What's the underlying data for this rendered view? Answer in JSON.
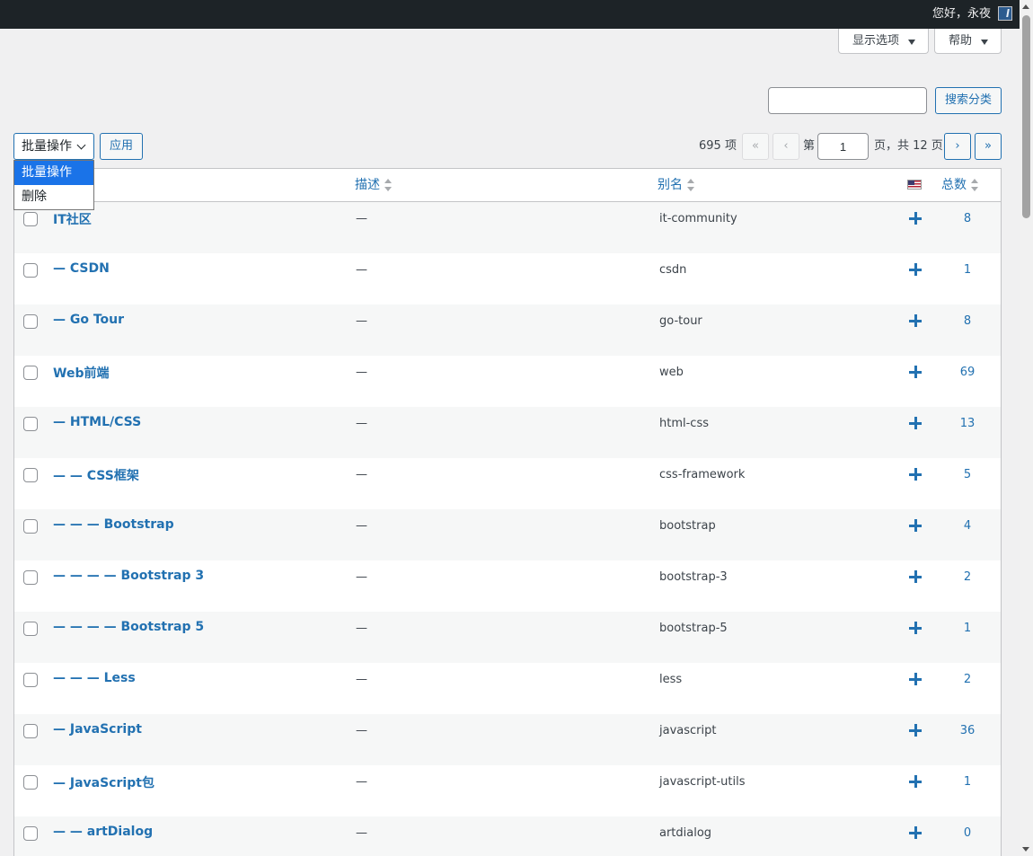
{
  "adminbar": {
    "greeting": "您好，永夜"
  },
  "screen_meta": {
    "options_label": "显示选项",
    "help_label": "帮助"
  },
  "search": {
    "value": "",
    "button_label": "搜索分类"
  },
  "bulk": {
    "selected": "批量操作",
    "apply_label": "应用",
    "options": [
      "批量操作",
      "删除"
    ]
  },
  "pagination": {
    "total_items": "695 项",
    "first": "«",
    "prev": "‹",
    "next": "›",
    "last": "»",
    "page_prefix": "第",
    "current_page": "1",
    "page_suffix": "页，共 12 页"
  },
  "table": {
    "columns": {
      "description": "描述",
      "slug": "别名",
      "count": "总数"
    },
    "rows": [
      {
        "name": "IT社区",
        "description": "—",
        "slug": "it-community",
        "count": "8"
      },
      {
        "name": "— CSDN",
        "description": "—",
        "slug": "csdn",
        "count": "1"
      },
      {
        "name": "— Go Tour",
        "description": "—",
        "slug": "go-tour",
        "count": "8"
      },
      {
        "name": "Web前端",
        "description": "—",
        "slug": "web",
        "count": "69"
      },
      {
        "name": "— HTML/CSS",
        "description": "—",
        "slug": "html-css",
        "count": "13"
      },
      {
        "name": "— — CSS框架",
        "description": "—",
        "slug": "css-framework",
        "count": "5"
      },
      {
        "name": "— — — Bootstrap",
        "description": "—",
        "slug": "bootstrap",
        "count": "4"
      },
      {
        "name": "— — — — Bootstrap 3",
        "description": "—",
        "slug": "bootstrap-3",
        "count": "2"
      },
      {
        "name": "— — — — Bootstrap 5",
        "description": "—",
        "slug": "bootstrap-5",
        "count": "1"
      },
      {
        "name": "— — — Less",
        "description": "—",
        "slug": "less",
        "count": "2"
      },
      {
        "name": "— JavaScript",
        "description": "—",
        "slug": "javascript",
        "count": "36"
      },
      {
        "name": "— JavaScript包",
        "description": "—",
        "slug": "javascript-utils",
        "count": "1"
      },
      {
        "name": "— — artDialog",
        "description": "—",
        "slug": "artdialog",
        "count": "0"
      }
    ]
  },
  "colors": {
    "link": "#2271b1",
    "adminbar": "#1d2327",
    "background": "#f0f0f1",
    "row_alt": "#f6f7f7"
  }
}
